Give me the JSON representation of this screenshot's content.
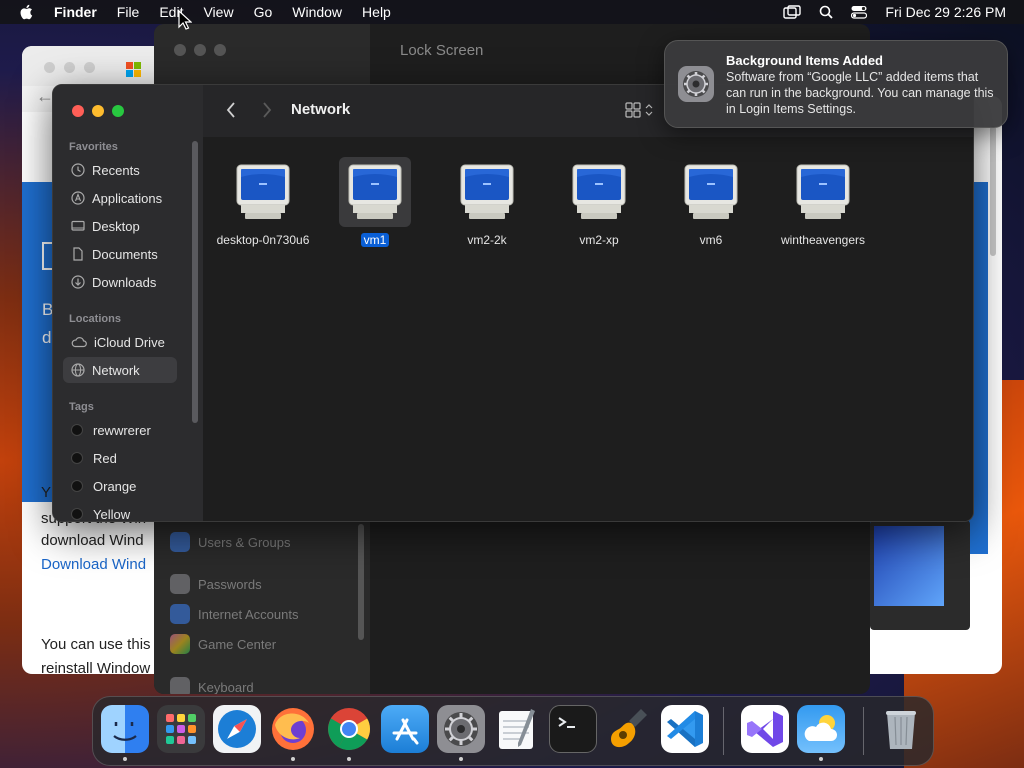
{
  "menubar": {
    "app_name": "Finder",
    "menus": [
      "File",
      "Edit",
      "View",
      "Go",
      "Window",
      "Help"
    ],
    "datetime": "Fri Dec 29  2:26 PM"
  },
  "background_settings": {
    "title": "Lock Screen",
    "sidebar_items": [
      "Users & Groups",
      "Passwords",
      "Internet Accounts",
      "Game Center",
      "Keyboard"
    ]
  },
  "background_browser": {
    "lines": [
      "B",
      "d",
      "Y",
      "support the Win",
      "download Wind",
      "You can use this",
      "reinstall Window"
    ],
    "link": "Download Wind"
  },
  "finder": {
    "title": "Network",
    "sidebar": {
      "favorites_header": "Favorites",
      "favorites": [
        "Recents",
        "Applications",
        "Desktop",
        "Documents",
        "Downloads"
      ],
      "locations_header": "Locations",
      "locations": [
        "iCloud Drive",
        "Network"
      ],
      "tags_header": "Tags",
      "tags": [
        "rewwrerer",
        "Red",
        "Orange",
        "Yellow"
      ]
    },
    "items": [
      {
        "name": "desktop-0n730u6",
        "selected": false
      },
      {
        "name": "vm1",
        "selected": true
      },
      {
        "name": "vm2-2k",
        "selected": false
      },
      {
        "name": "vm2-xp",
        "selected": false
      },
      {
        "name": "vm6",
        "selected": false
      },
      {
        "name": "wintheavengers",
        "selected": false
      }
    ]
  },
  "notification": {
    "title": "Background Items Added",
    "body": "Software from “Google LLC” added items that can run in the background. You can manage this in Login Items Settings."
  },
  "dock": {
    "apps": [
      "finder",
      "launchpad",
      "safari",
      "firefox",
      "chrome",
      "app-store",
      "system-settings",
      "textedit",
      "terminal",
      "garageband",
      "vscode",
      "visual-studio",
      "weather",
      "trash"
    ]
  }
}
